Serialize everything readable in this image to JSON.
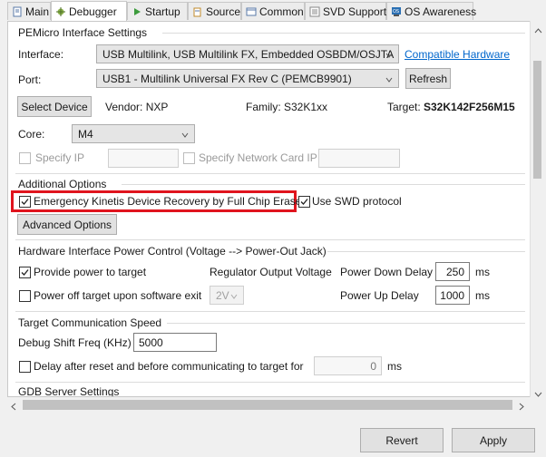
{
  "tabs": [
    {
      "label": "Main",
      "icon": "main-tab-icon"
    },
    {
      "label": "Debugger",
      "icon": "debugger-tab-icon",
      "active": true
    },
    {
      "label": "Startup",
      "icon": "startup-tab-icon"
    },
    {
      "label": "Source",
      "icon": "source-tab-icon"
    },
    {
      "label": "Common",
      "icon": "common-tab-icon"
    },
    {
      "label": "SVD Support",
      "icon": "svd-tab-icon"
    },
    {
      "label": "OS Awareness",
      "icon": "os-awareness-tab-icon"
    }
  ],
  "pemicro": {
    "title": "PEMicro Interface Settings",
    "interface_label": "Interface:",
    "interface_value": "USB Multilink, USB Multilink FX, Embedded OSBDM/OSJTA",
    "compatible_link": "Compatible Hardware",
    "port_label": "Port:",
    "port_value": "USB1 - Multilink Universal FX Rev C (PEMCB9901)",
    "refresh_label": "Refresh",
    "select_device_label": "Select Device",
    "vendor": "Vendor: NXP",
    "family": "Family: S32K1xx",
    "target_label": "Target:",
    "target_value": "S32K142F256M15",
    "core_label": "Core:",
    "core_value": "M4",
    "specify_ip_label": "Specify IP",
    "specify_ip_value": "",
    "specify_nic_label": "Specify Network Card IP",
    "specify_nic_value": ""
  },
  "additional": {
    "title": "Additional Options",
    "emergency_label": "Emergency Kinetis Device Recovery by Full Chip Erase",
    "emergency_checked": true,
    "swd_label": "Use SWD protocol",
    "swd_checked": true,
    "advanced_label": "Advanced Options"
  },
  "power": {
    "title": "Hardware Interface Power Control (Voltage --> Power-Out Jack)",
    "provide_label": "Provide power to target",
    "provide_checked": true,
    "regulator_label": "Regulator Output Voltage",
    "power_down_label": "Power Down Delay",
    "power_down_value": "250",
    "power_down_unit": "ms",
    "power_off_label": "Power off target upon software exit",
    "power_off_checked": false,
    "voltage_value": "2V",
    "power_up_label": "Power Up Delay",
    "power_up_value": "1000",
    "power_up_unit": "ms"
  },
  "comm": {
    "title": "Target Communication Speed",
    "shift_label": "Debug Shift Freq (KHz)",
    "shift_value": "5000",
    "delay_label": "Delay after reset and before communicating to target for",
    "delay_value": "0",
    "delay_unit": "ms",
    "delay_checked": false
  },
  "gdb": {
    "title": "GDB Server Settings"
  },
  "buttons": {
    "revert": "Revert",
    "apply": "Apply"
  },
  "colors": {
    "highlight": "#e0141e",
    "link": "#0066cc"
  }
}
